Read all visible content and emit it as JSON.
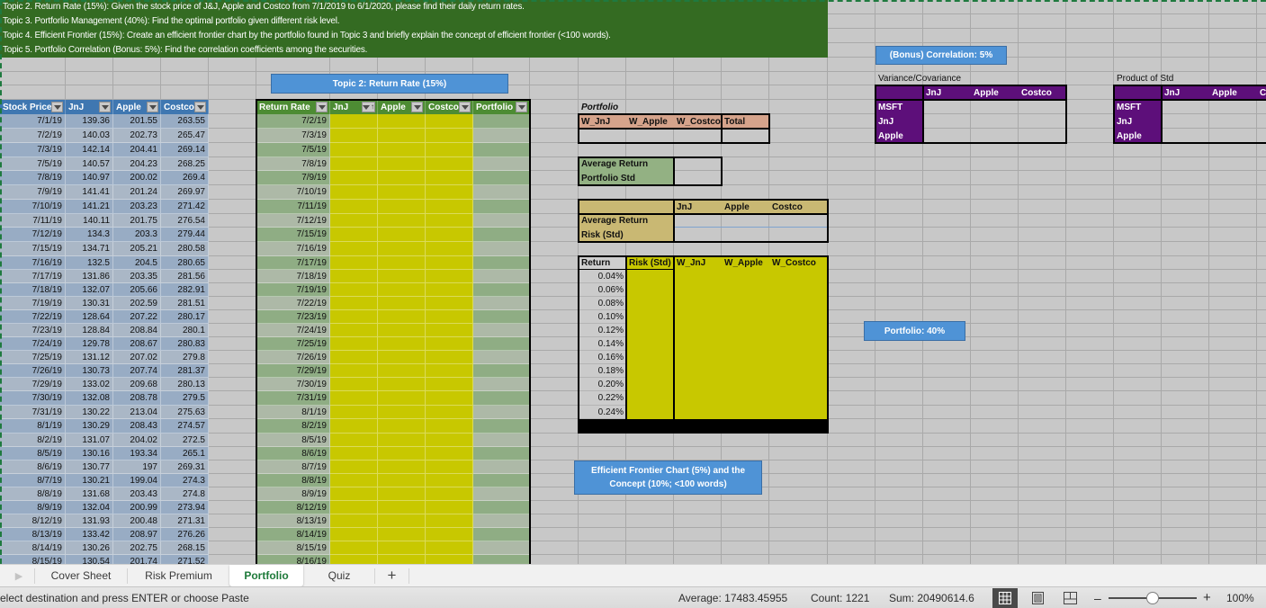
{
  "theme": {
    "sheet_gray": "#c8c8c8",
    "banner_green": "#346b22",
    "stock_header_blue": "#3f77b1",
    "stock_row_dark": "#98acc4",
    "stock_row_light": "#aab7c6",
    "return_header_green": "#4d8c33",
    "return_row_dark": "#8fad84",
    "return_row_light": "#adb9a7",
    "input_yellow": "#c8c800",
    "weights_salmon": "#d5a38b",
    "avg_green": "#93b183",
    "khaki": "#c9b873",
    "purple": "#5d0f7a",
    "button_blue": "#4f93d6",
    "active_tab_green": "#1e7a3a"
  },
  "banner": {
    "topics": [
      "Topic 2. Return Rate (15%): Given the stock price of J&J, Apple and Costco from 7/1/2019 to 6/1/2020, please find their daily return rates.",
      "Topic 3. Portforlio Management (40%): Find the optimal portfolio given different risk level.",
      "Topic 4. Efficient Frontier (15%): Create an efficient frontier chart by the portfolio found in Topic 3 and briefly explain the concept of efficient frontier (<100 words).",
      "Topic 5. Portfolio Correlation (Bonus: 5%): Find the correlation coefficients among the securities."
    ]
  },
  "buttons": {
    "topic2": "Topic 2: Return Rate (15%)",
    "bonus": "(Bonus) Correlation: 5%",
    "portfolio": "Portfolio: 40%",
    "efficient_frontier": "Efficient Frontier Chart (5%) and the Concept (10%; <100 words)"
  },
  "stock_table": {
    "headers": [
      "Stock Price",
      "JnJ",
      "Apple",
      "Costco"
    ],
    "rows": [
      [
        "7/1/19",
        "139.36",
        "201.55",
        "263.55"
      ],
      [
        "7/2/19",
        "140.03",
        "202.73",
        "265.47"
      ],
      [
        "7/3/19",
        "142.14",
        "204.41",
        "269.14"
      ],
      [
        "7/5/19",
        "140.57",
        "204.23",
        "268.25"
      ],
      [
        "7/8/19",
        "140.97",
        "200.02",
        "269.4"
      ],
      [
        "7/9/19",
        "141.41",
        "201.24",
        "269.97"
      ],
      [
        "7/10/19",
        "141.21",
        "203.23",
        "271.42"
      ],
      [
        "7/11/19",
        "140.11",
        "201.75",
        "276.54"
      ],
      [
        "7/12/19",
        "134.3",
        "203.3",
        "279.44"
      ],
      [
        "7/15/19",
        "134.71",
        "205.21",
        "280.58"
      ],
      [
        "7/16/19",
        "132.5",
        "204.5",
        "280.65"
      ],
      [
        "7/17/19",
        "131.86",
        "203.35",
        "281.56"
      ],
      [
        "7/18/19",
        "132.07",
        "205.66",
        "282.91"
      ],
      [
        "7/19/19",
        "130.31",
        "202.59",
        "281.51"
      ],
      [
        "7/22/19",
        "128.64",
        "207.22",
        "280.17"
      ],
      [
        "7/23/19",
        "128.84",
        "208.84",
        "280.1"
      ],
      [
        "7/24/19",
        "129.78",
        "208.67",
        "280.83"
      ],
      [
        "7/25/19",
        "131.12",
        "207.02",
        "279.8"
      ],
      [
        "7/26/19",
        "130.73",
        "207.74",
        "281.37"
      ],
      [
        "7/29/19",
        "133.02",
        "209.68",
        "280.13"
      ],
      [
        "7/30/19",
        "132.08",
        "208.78",
        "279.5"
      ],
      [
        "7/31/19",
        "130.22",
        "213.04",
        "275.63"
      ],
      [
        "8/1/19",
        "130.29",
        "208.43",
        "274.57"
      ],
      [
        "8/2/19",
        "131.07",
        "204.02",
        "272.5"
      ],
      [
        "8/5/19",
        "130.16",
        "193.34",
        "265.1"
      ],
      [
        "8/6/19",
        "130.77",
        "197",
        "269.31"
      ],
      [
        "8/7/19",
        "130.21",
        "199.04",
        "274.3"
      ],
      [
        "8/8/19",
        "131.68",
        "203.43",
        "274.8"
      ],
      [
        "8/9/19",
        "132.04",
        "200.99",
        "273.94"
      ],
      [
        "8/12/19",
        "131.93",
        "200.48",
        "271.31"
      ],
      [
        "8/13/19",
        "133.42",
        "208.97",
        "276.26"
      ],
      [
        "8/14/19",
        "130.26",
        "202.75",
        "268.15"
      ],
      [
        "8/15/19",
        "130.54",
        "201.74",
        "271.52"
      ]
    ]
  },
  "return_table": {
    "headers": [
      "Return Rate",
      "JnJ",
      "Apple",
      "Costco",
      "Portfolio"
    ],
    "sorted_column": "JnJ",
    "dates": [
      "7/2/19",
      "7/3/19",
      "7/5/19",
      "7/8/19",
      "7/9/19",
      "7/10/19",
      "7/11/19",
      "7/12/19",
      "7/15/19",
      "7/16/19",
      "7/17/19",
      "7/18/19",
      "7/19/19",
      "7/22/19",
      "7/23/19",
      "7/24/19",
      "7/25/19",
      "7/26/19",
      "7/29/19",
      "7/30/19",
      "7/31/19",
      "8/1/19",
      "8/2/19",
      "8/5/19",
      "8/6/19",
      "8/7/19",
      "8/8/19",
      "8/9/19",
      "8/12/19",
      "8/13/19",
      "8/14/19",
      "8/15/19",
      "8/16/19"
    ]
  },
  "portfolio": {
    "label": "Portfolio",
    "weight_headers": [
      "W_JnJ",
      "W_Apple",
      "W_Costco",
      "Total"
    ],
    "avg_return_label": "Average Return",
    "portfolio_std_label": "Portfolio Std"
  },
  "asset_stats": {
    "headers": [
      "JnJ",
      "Apple",
      "Costco"
    ],
    "row_labels": [
      "Average Return",
      "Risk (Std)"
    ]
  },
  "frontier_table": {
    "headers": [
      "Return",
      "Risk (Std)",
      "W_JnJ",
      "W_Apple",
      "W_Costco"
    ],
    "returns": [
      "0.04%",
      "0.06%",
      "0.08%",
      "0.10%",
      "0.12%",
      "0.14%",
      "0.16%",
      "0.18%",
      "0.20%",
      "0.22%",
      "0.24%"
    ]
  },
  "covariance": {
    "title": "Variance/Covariance",
    "col_headers": [
      "JnJ",
      "Apple",
      "Costco"
    ],
    "row_headers": [
      "MSFT",
      "JnJ",
      "Apple"
    ]
  },
  "product_std": {
    "title": "Product of Std",
    "col_headers": [
      "JnJ",
      "Apple",
      "Costco"
    ],
    "row_headers": [
      "MSFT",
      "JnJ",
      "Apple"
    ]
  },
  "sheet_tabs": {
    "tabs": [
      "Cover Sheet",
      "Risk Premium",
      "Portfolio",
      "Quiz"
    ],
    "active": "Portfolio",
    "add_label": "+"
  },
  "status_bar": {
    "message": "elect destination and press ENTER or choose Paste",
    "average": "Average: 17483.45955",
    "count": "Count: 1221",
    "sum": "Sum: 20490614.6",
    "zoom_out": "–",
    "zoom_in": "+",
    "zoom": "100%"
  }
}
